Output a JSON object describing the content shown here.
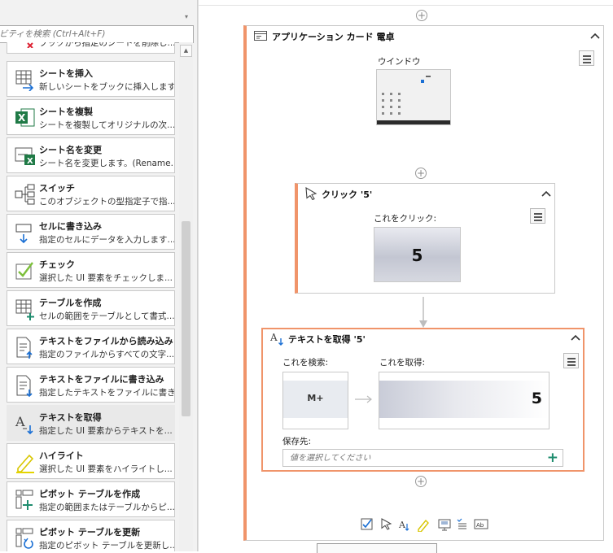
{
  "panel": {
    "search_placeholder": "ビティを検索 (Ctrl+Alt+F)",
    "partial_item_desc": "ブックから指定のシートを削除し...",
    "activities": [
      {
        "title": "シートを挿入",
        "desc": "新しいシートをブックに挿入します...",
        "icon": "insert-sheet-icon"
      },
      {
        "title": "シートを複製",
        "desc": "シートを複製してオリジナルの次...",
        "icon": "excel-icon"
      },
      {
        "title": "シート名を変更",
        "desc": "シート名を変更します。(Rename...",
        "icon": "rename-sheet-icon"
      },
      {
        "title": "スイッチ",
        "desc": "このオブジェクトの型指定子で指...",
        "icon": "switch-icon"
      },
      {
        "title": "セルに書き込み",
        "desc": "指定のセルにデータを入力します...",
        "icon": "write-cell-icon"
      },
      {
        "title": "チェック",
        "desc": "選択した UI 要素をチェックしま...",
        "icon": "check-icon"
      },
      {
        "title": "テーブルを作成",
        "desc": "セルの範囲をテーブルとして書式...",
        "icon": "create-table-icon"
      },
      {
        "title": "テキストをファイルから読み込み",
        "desc": "指定のファイルからすべての文字...",
        "icon": "read-text-file-icon"
      },
      {
        "title": "テキストをファイルに書き込み",
        "desc": "指定したテキストをファイルに書き...",
        "icon": "write-text-file-icon"
      },
      {
        "title": "テキストを取得",
        "desc": "指定した UI 要素からテキストを...",
        "icon": "get-text-icon"
      },
      {
        "title": "ハイライト",
        "desc": "選択した UI 要素をハイライトし...",
        "icon": "highlight-icon"
      },
      {
        "title": "ピボット テーブルを作成",
        "desc": "指定の範囲またはテーブルからピ...",
        "icon": "create-pivot-icon"
      },
      {
        "title": "ピボット テーブルを更新",
        "desc": "指定のピボット テーブルを更新し...",
        "icon": "refresh-pivot-icon"
      }
    ]
  },
  "workflow": {
    "app_card": {
      "title": "アプリケーション カード 電卓",
      "window_label": "ウインドウ"
    },
    "click_card": {
      "title": "クリック '5'",
      "click_label": "これをクリック:",
      "preview_value": "5"
    },
    "gettext_card": {
      "title": "テキストを取得 '5'",
      "search_label": "これを検索:",
      "search_value": "M+",
      "get_label": "これを取得:",
      "get_value": "5",
      "save_label": "保存先:",
      "save_placeholder": "値を選択してください"
    }
  },
  "colors": {
    "accent": "#f0946a",
    "plus_green": "#1e8c6e",
    "blue_arrow": "#1a6fd4"
  }
}
